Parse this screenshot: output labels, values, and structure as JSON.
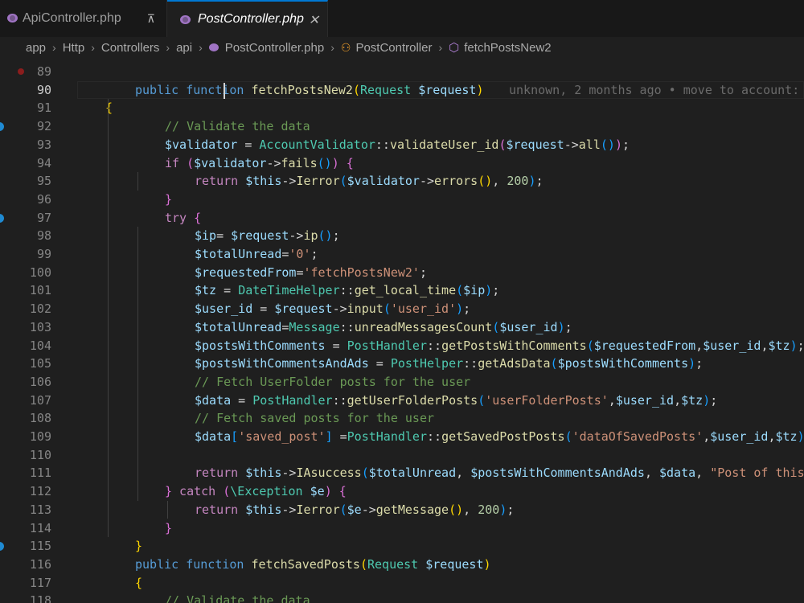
{
  "tabs": [
    {
      "label": "ApiController.php",
      "icon": "php-file-icon",
      "action": "⊼",
      "action_name": "pin-icon",
      "active": false
    },
    {
      "label": "PostController.php",
      "icon": "php-file-icon",
      "action": "✕",
      "action_name": "close-icon",
      "active": true
    }
  ],
  "breadcrumb": {
    "segments": [
      "app",
      "Http",
      "Controllers",
      "api",
      "PostController.php",
      "PostController",
      "fetchPostsNew2"
    ]
  },
  "editor": {
    "blame": "unknown, 2 months ago • move to account:",
    "lines": [
      {
        "n": "89",
        "tokens": []
      },
      {
        "n": "90",
        "tokens": [
          [
            "kw",
            "public "
          ],
          [
            "kw",
            "function "
          ],
          [
            "fn",
            "fetchPostsNew2"
          ],
          [
            "br1",
            "("
          ],
          [
            "cls",
            "Request "
          ],
          [
            "var",
            "$request"
          ],
          [
            "br1",
            ")"
          ]
        ]
      },
      {
        "n": "91",
        "tokens": [
          [
            "br1",
            "{"
          ]
        ]
      },
      {
        "n": "92",
        "tokens": [
          [
            "com",
            "// Validate the data"
          ]
        ]
      },
      {
        "n": "93",
        "tokens": [
          [
            "var",
            "$validator"
          ],
          [
            "op",
            " = "
          ],
          [
            "cls",
            "AccountValidator"
          ],
          [
            "op",
            "::"
          ],
          [
            "fn",
            "validateUser_id"
          ],
          [
            "br2",
            "("
          ],
          [
            "var",
            "$request"
          ],
          [
            "op",
            "->"
          ],
          [
            "fn",
            "all"
          ],
          [
            "br3",
            "()"
          ],
          [
            "br2",
            ")"
          ],
          [
            "pn",
            ";"
          ]
        ]
      },
      {
        "n": "94",
        "tokens": [
          [
            "ctl",
            "if "
          ],
          [
            "br2",
            "("
          ],
          [
            "var",
            "$validator"
          ],
          [
            "op",
            "->"
          ],
          [
            "fn",
            "fails"
          ],
          [
            "br3",
            "()"
          ],
          [
            "br2",
            ")"
          ],
          [
            "pn",
            " "
          ],
          [
            "br2",
            "{"
          ]
        ]
      },
      {
        "n": "95",
        "tokens": [
          [
            "ctl",
            "return "
          ],
          [
            "var",
            "$this"
          ],
          [
            "op",
            "->"
          ],
          [
            "fn",
            "Ierror"
          ],
          [
            "br3",
            "("
          ],
          [
            "var",
            "$validator"
          ],
          [
            "op",
            "->"
          ],
          [
            "fn",
            "errors"
          ],
          [
            "br1",
            "()"
          ],
          [
            "pn",
            ", "
          ],
          [
            "num",
            "200"
          ],
          [
            "br3",
            ")"
          ],
          [
            "pn",
            ";"
          ]
        ]
      },
      {
        "n": "96",
        "tokens": [
          [
            "br2",
            "}"
          ]
        ]
      },
      {
        "n": "97",
        "tokens": [
          [
            "ctl",
            "try "
          ],
          [
            "br2",
            "{"
          ]
        ]
      },
      {
        "n": "98",
        "tokens": [
          [
            "var",
            "$ip"
          ],
          [
            "op",
            "= "
          ],
          [
            "var",
            "$request"
          ],
          [
            "op",
            "->"
          ],
          [
            "fn",
            "ip"
          ],
          [
            "br3",
            "()"
          ],
          [
            "pn",
            ";"
          ]
        ]
      },
      {
        "n": "99",
        "tokens": [
          [
            "var",
            "$totalUnread"
          ],
          [
            "op",
            "="
          ],
          [
            "str",
            "'0'"
          ],
          [
            "pn",
            ";"
          ]
        ]
      },
      {
        "n": "100",
        "tokens": [
          [
            "var",
            "$requestedFrom"
          ],
          [
            "op",
            "="
          ],
          [
            "str",
            "'fetchPostsNew2'"
          ],
          [
            "pn",
            ";"
          ]
        ]
      },
      {
        "n": "101",
        "tokens": [
          [
            "var",
            "$tz"
          ],
          [
            "op",
            " = "
          ],
          [
            "cls",
            "DateTimeHelper"
          ],
          [
            "op",
            "::"
          ],
          [
            "fn",
            "get_local_time"
          ],
          [
            "br3",
            "("
          ],
          [
            "var",
            "$ip"
          ],
          [
            "br3",
            ")"
          ],
          [
            "pn",
            ";"
          ]
        ]
      },
      {
        "n": "102",
        "tokens": [
          [
            "var",
            "$user_id"
          ],
          [
            "op",
            " = "
          ],
          [
            "var",
            "$request"
          ],
          [
            "op",
            "->"
          ],
          [
            "fn",
            "input"
          ],
          [
            "br3",
            "("
          ],
          [
            "str",
            "'user_id'"
          ],
          [
            "br3",
            ")"
          ],
          [
            "pn",
            ";"
          ]
        ]
      },
      {
        "n": "103",
        "tokens": [
          [
            "var",
            "$totalUnread"
          ],
          [
            "op",
            "="
          ],
          [
            "cls",
            "Message"
          ],
          [
            "op",
            "::"
          ],
          [
            "fn",
            "unreadMessagesCount"
          ],
          [
            "br3",
            "("
          ],
          [
            "var",
            "$user_id"
          ],
          [
            "br3",
            ")"
          ],
          [
            "pn",
            ";"
          ]
        ]
      },
      {
        "n": "104",
        "tokens": [
          [
            "var",
            "$postsWithComments"
          ],
          [
            "op",
            " = "
          ],
          [
            "cls",
            "PostHandler"
          ],
          [
            "op",
            "::"
          ],
          [
            "fn",
            "getPostsWithComments"
          ],
          [
            "br3",
            "("
          ],
          [
            "var",
            "$requestedFrom"
          ],
          [
            "pn",
            ","
          ],
          [
            "var",
            "$user_id"
          ],
          [
            "pn",
            ","
          ],
          [
            "var",
            "$tz"
          ],
          [
            "br3",
            ")"
          ],
          [
            "pn",
            ";"
          ]
        ]
      },
      {
        "n": "105",
        "tokens": [
          [
            "var",
            "$postsWithCommentsAndAds"
          ],
          [
            "op",
            " = "
          ],
          [
            "cls",
            "PostHelper"
          ],
          [
            "op",
            "::"
          ],
          [
            "fn",
            "getAdsData"
          ],
          [
            "br3",
            "("
          ],
          [
            "var",
            "$postsWithComments"
          ],
          [
            "br3",
            ")"
          ],
          [
            "pn",
            ";"
          ]
        ]
      },
      {
        "n": "106",
        "tokens": [
          [
            "com",
            "// Fetch UserFolder posts for the user"
          ]
        ]
      },
      {
        "n": "107",
        "tokens": [
          [
            "var",
            "$data"
          ],
          [
            "op",
            " = "
          ],
          [
            "cls",
            "PostHandler"
          ],
          [
            "op",
            "::"
          ],
          [
            "fn",
            "getUserFolderPosts"
          ],
          [
            "br3",
            "("
          ],
          [
            "str",
            "'userFolderPosts'"
          ],
          [
            "pn",
            ","
          ],
          [
            "var",
            "$user_id"
          ],
          [
            "pn",
            ","
          ],
          [
            "var",
            "$tz"
          ],
          [
            "br3",
            ")"
          ],
          [
            "pn",
            ";"
          ]
        ]
      },
      {
        "n": "108",
        "tokens": [
          [
            "com",
            "// Fetch saved posts for the user"
          ]
        ]
      },
      {
        "n": "109",
        "tokens": [
          [
            "var",
            "$data"
          ],
          [
            "br3",
            "["
          ],
          [
            "str",
            "'saved_post'"
          ],
          [
            "br3",
            "]"
          ],
          [
            "op",
            " ="
          ],
          [
            "cls",
            "PostHandler"
          ],
          [
            "op",
            "::"
          ],
          [
            "fn",
            "getSavedPostPosts"
          ],
          [
            "br3",
            "("
          ],
          [
            "str",
            "'dataOfSavedPosts'"
          ],
          [
            "pn",
            ","
          ],
          [
            "var",
            "$user_id"
          ],
          [
            "pn",
            ","
          ],
          [
            "var",
            "$tz"
          ],
          [
            "br3",
            ")"
          ],
          [
            "pn",
            ";"
          ]
        ]
      },
      {
        "n": "110",
        "tokens": []
      },
      {
        "n": "111",
        "tokens": [
          [
            "ctl",
            "return "
          ],
          [
            "var",
            "$this"
          ],
          [
            "op",
            "->"
          ],
          [
            "fn",
            "IAsuccess"
          ],
          [
            "br3",
            "("
          ],
          [
            "var",
            "$totalUnread"
          ],
          [
            "pn",
            ", "
          ],
          [
            "var",
            "$postsWithCommentsAndAds"
          ],
          [
            "pn",
            ", "
          ],
          [
            "var",
            "$data"
          ],
          [
            "pn",
            ", "
          ],
          [
            "str",
            "\"Post of this us"
          ]
        ]
      },
      {
        "n": "112",
        "tokens": [
          [
            "br2",
            "}"
          ],
          [
            "ctl",
            " catch "
          ],
          [
            "br2",
            "("
          ],
          [
            "cls",
            "\\Exception "
          ],
          [
            "var",
            "$e"
          ],
          [
            "br2",
            ")"
          ],
          [
            "pn",
            " "
          ],
          [
            "br2",
            "{"
          ]
        ]
      },
      {
        "n": "113",
        "tokens": [
          [
            "ctl",
            "return "
          ],
          [
            "var",
            "$this"
          ],
          [
            "op",
            "->"
          ],
          [
            "fn",
            "Ierror"
          ],
          [
            "br3",
            "("
          ],
          [
            "var",
            "$e"
          ],
          [
            "op",
            "->"
          ],
          [
            "fn",
            "getMessage"
          ],
          [
            "br1",
            "()"
          ],
          [
            "pn",
            ", "
          ],
          [
            "num",
            "200"
          ],
          [
            "br3",
            ")"
          ],
          [
            "pn",
            ";"
          ]
        ]
      },
      {
        "n": "114",
        "tokens": [
          [
            "br2",
            "}"
          ]
        ]
      },
      {
        "n": "115",
        "tokens": [
          [
            "br1",
            "}"
          ]
        ]
      },
      {
        "n": "116",
        "tokens": [
          [
            "kw",
            "public "
          ],
          [
            "kw",
            "function "
          ],
          [
            "fn",
            "fetchSavedPosts"
          ],
          [
            "br1",
            "("
          ],
          [
            "cls",
            "Request "
          ],
          [
            "var",
            "$request"
          ],
          [
            "br1",
            ")"
          ]
        ]
      },
      {
        "n": "117",
        "tokens": [
          [
            "br1",
            "{"
          ]
        ]
      },
      {
        "n": "118",
        "tokens": [
          [
            "com",
            "// Validate the data"
          ]
        ]
      }
    ]
  }
}
